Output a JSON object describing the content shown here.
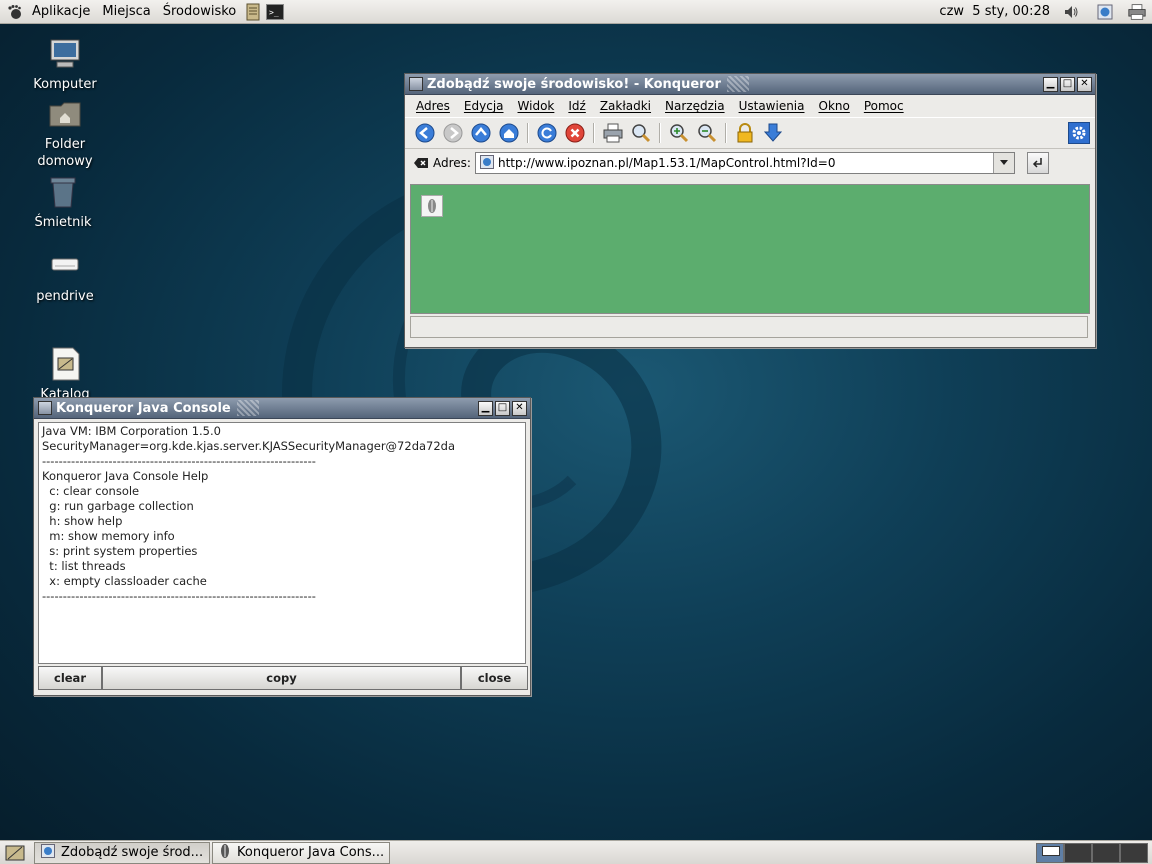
{
  "top_panel": {
    "menu": [
      "Aplikacje",
      "Miejsca",
      "Środowisko"
    ],
    "clock": "czw  5 sty, 00:28",
    "icons": [
      "gnome-foot-icon",
      "text-editor-icon",
      "terminal-icon",
      "volume-icon",
      "browser-status-icon",
      "printer-icon"
    ]
  },
  "desktop_icons": [
    {
      "label": "Komputer",
      "icon": "computer-icon"
    },
    {
      "label": "Folder\ndomowy",
      "icon": "home-folder-icon"
    },
    {
      "label": "Śmietnik",
      "icon": "trash-icon"
    },
    {
      "label": "pendrive",
      "icon": "usb-drive-icon"
    },
    {
      "label": "Katalog",
      "icon": "catalog-icon"
    }
  ],
  "konqueror": {
    "title": "Zdobądź swoje środowisko! - Konqueror",
    "menu": [
      "Adres",
      "Edycja",
      "Widok",
      "Idź",
      "Zakładki",
      "Narzędzia",
      "Ustawienia",
      "Okno",
      "Pomoc"
    ],
    "toolbar": [
      "back-icon",
      "forward-icon",
      "up-icon",
      "home-icon",
      "reload-icon",
      "stop-icon",
      "print-icon",
      "find-icon",
      "zoom-in-icon",
      "zoom-out-icon",
      "security-lock-icon",
      "download-icon"
    ],
    "location_label": "Adres:",
    "url": "http://www.ipoznan.pl/Map1.53.1/MapControl.html?Id=0",
    "page_bg": "#5cad6e",
    "status": ""
  },
  "java_console": {
    "title": "Konqueror Java Console",
    "lines": "Java VM: IBM Corporation 1.5.0\nSecurityManager=org.kde.kjas.server.KJASSecurityManager@72da72da\n------------------------------------------------------------------\nKonqueror Java Console Help\n  c: clear console\n  g: run garbage collection\n  h: show help\n  m: show memory info\n  s: print system properties\n  t: list threads\n  x: empty classloader cache\n------------------------------------------------------------------",
    "buttons": {
      "clear": "clear",
      "copy": "copy",
      "close": "close"
    }
  },
  "taskbar": {
    "tasks": [
      {
        "label": "Zdobądź swoje środ...",
        "active": true
      },
      {
        "label": "Konqueror Java Cons...",
        "active": false
      }
    ]
  },
  "colors": {
    "desktop": "#0f3f57",
    "titlebar": "#54647a",
    "page_green": "#5cad6e"
  }
}
